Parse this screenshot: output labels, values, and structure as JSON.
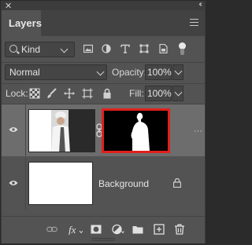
{
  "panel": {
    "close_glyph": "✕",
    "collapse_glyph": "‹‹",
    "tab_label": "Layers"
  },
  "filter": {
    "kind_label": "Kind",
    "icons": [
      "image-filter-icon",
      "adjustment-filter-icon",
      "type-filter-icon",
      "shape-filter-icon",
      "smart-object-filter-icon"
    ]
  },
  "blend": {
    "mode": "Normal",
    "opacity_label": "Opacity:",
    "opacity_value": "100%"
  },
  "lock": {
    "label": "Lock:",
    "fill_label": "Fill:",
    "fill_value": "100%"
  },
  "layers": [
    {
      "name": "",
      "visible": true,
      "selected": true,
      "has_mask": true
    },
    {
      "name": "Background",
      "visible": true,
      "selected": false,
      "locked": true
    }
  ],
  "more_glyph": "···",
  "colors": {
    "panel_bg": "#535353",
    "selected_row": "#6d6d6d",
    "mask_border": "#e0201c"
  }
}
